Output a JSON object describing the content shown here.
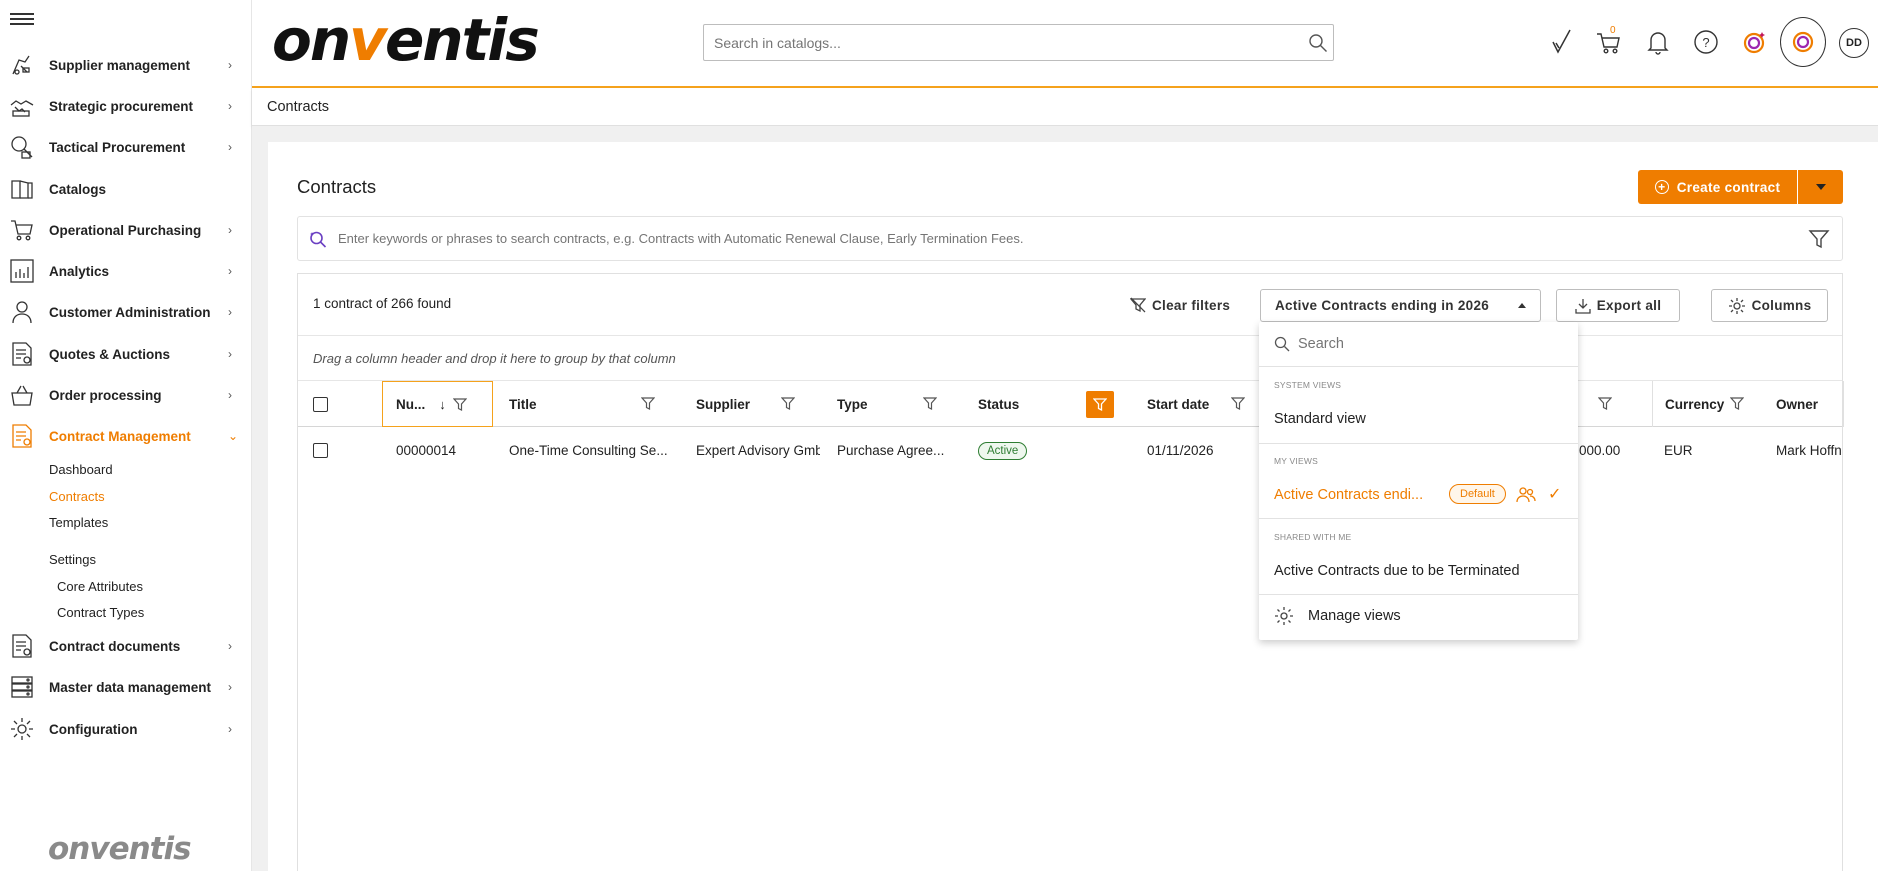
{
  "sidebar": {
    "items": [
      {
        "label": "Supplier management",
        "icon": "supplier-icon"
      },
      {
        "label": "Strategic procurement",
        "icon": "handshake-icon"
      },
      {
        "label": "Tactical Procurement",
        "icon": "magnifier-icon"
      },
      {
        "label": "Catalogs",
        "icon": "book-icon"
      },
      {
        "label": "Operational Purchasing",
        "icon": "cart-icon"
      },
      {
        "label": "Analytics",
        "icon": "bar-chart-icon"
      },
      {
        "label": "Customer Administration",
        "icon": "user-icon"
      },
      {
        "label": "Quotes & Auctions",
        "icon": "quote-icon"
      },
      {
        "label": "Order processing",
        "icon": "basket-icon"
      },
      {
        "label": "Contract Management",
        "icon": "contract-icon"
      },
      {
        "label": "Contract documents",
        "icon": "document-icon"
      },
      {
        "label": "Master data management",
        "icon": "server-icon"
      },
      {
        "label": "Configuration",
        "icon": "gear-icon"
      }
    ],
    "contract_sub": {
      "dashboard": "Dashboard",
      "contracts": "Contracts",
      "templates": "Templates",
      "settings": "Settings",
      "core_attributes": "Core Attributes",
      "contract_types": "Contract Types"
    },
    "footer_logo": "onventis"
  },
  "header": {
    "logo_left": "on",
    "logo_v": "v",
    "logo_right": "entis",
    "search_placeholder": "Search in catalogs...",
    "cart_count": "0",
    "avatar": "DD",
    "accent": "#ef7d00"
  },
  "breadcrumb": "Contracts",
  "page": {
    "title": "Contracts",
    "create_label": "Create contract",
    "ai_search_placeholder": "Enter keywords or phrases to search contracts, e.g. Contracts with Automatic Renewal Clause, Early Termination Fees."
  },
  "grid": {
    "result_count": "1 contract of 266 found",
    "clear_filters": "Clear filters",
    "selected_view": "Active Contracts ending in 2026",
    "export_all": "Export all",
    "columns": "Columns",
    "group_hint": "Drag a column header and drop it here to group by that column",
    "headers": {
      "number": "Nu...",
      "title": "Title",
      "supplier": "Supplier",
      "type": "Type",
      "status": "Status",
      "start_date": "Start date",
      "currency": "Currency",
      "owner": "Owner"
    },
    "rows": [
      {
        "number": "00000014",
        "title": "One-Time Consulting Se...",
        "supplier": "Expert Advisory Gmb",
        "type": "Purchase Agree...",
        "status": "Active",
        "start_date": "01/11/2026",
        "value": "000.00",
        "currency": "EUR",
        "owner": "Mark Hoffn"
      }
    ]
  },
  "views_dropdown": {
    "search_placeholder": "Search",
    "system_views_label": "SYSTEM VIEWS",
    "standard_view": "Standard view",
    "my_views_label": "MY VIEWS",
    "my_view": "Active Contracts endi...",
    "default_badge": "Default",
    "shared_label": "SHARED WITH ME",
    "shared_view": "Active Contracts due to be Terminated",
    "manage_views": "Manage views"
  }
}
